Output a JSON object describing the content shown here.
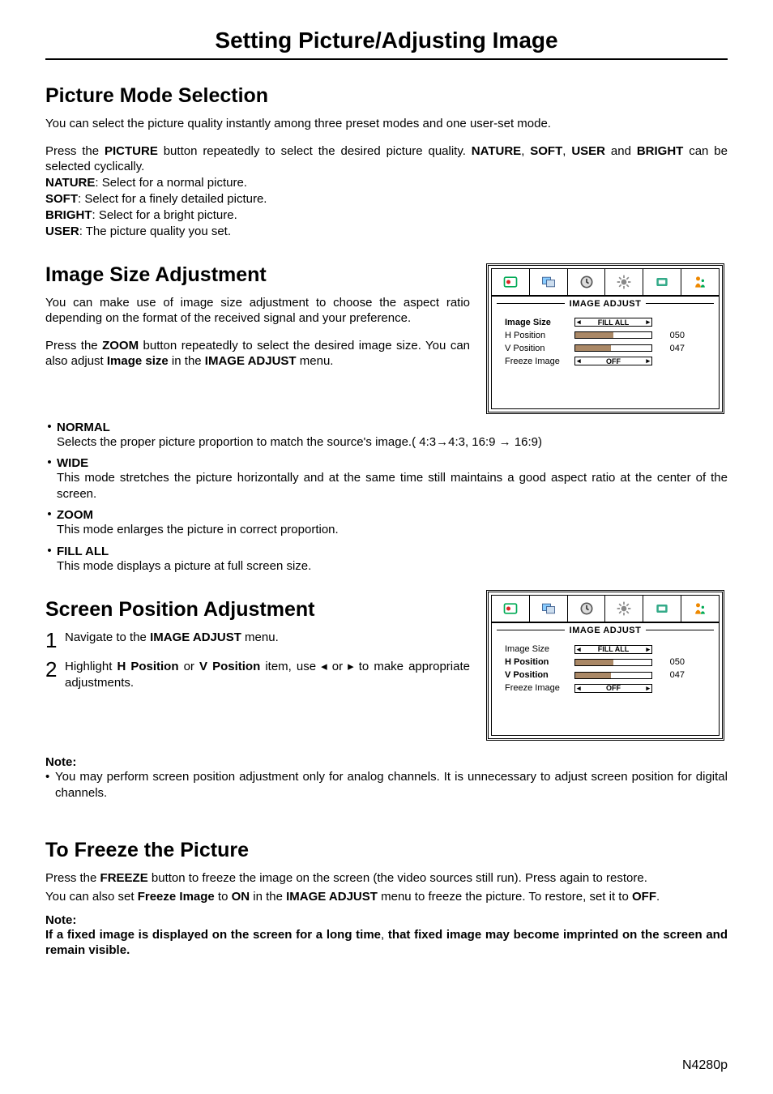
{
  "page_title": "Setting Picture/Adjusting Image",
  "footer_model": "N4280p",
  "sections": {
    "pms": {
      "heading": "Picture Mode Selection",
      "intro": "You can select the picture quality instantly among three preset modes and one user-set mode.",
      "p1_a": "Press the ",
      "p1_b": "PICTURE",
      "p1_c": " button repeatedly to select the desired picture quality. ",
      "p1_d": "NATURE",
      "p1_e": ", ",
      "p1_f": "SOFT",
      "p1_g": ", ",
      "p1_h": "USER",
      "p1_i": " and ",
      "p1_j": "BRIGHT",
      "p1_k": " can be selected cyclically.",
      "l1_a": "NATURE",
      "l1_b": ": Select for a normal picture.",
      "l2_a": "SOFT",
      "l2_b": ": Select for a finely detailed picture.",
      "l3_a": "BRIGHT",
      "l3_b": ": Select for a bright picture.",
      "l4_a": "USER",
      "l4_b": ": The picture quality you set."
    },
    "isa": {
      "heading": "Image Size Adjustment",
      "p1": "You can make use of image size adjustment to choose the aspect ratio depending on the format of the received signal and your preference.",
      "p2_a": "Press the ",
      "p2_b": "ZOOM",
      "p2_c": " button repeatedly to select the desired image size. You can also adjust ",
      "p2_d": "Image size",
      "p2_e": " in the ",
      "p2_f": "IMAGE ADJUST",
      "p2_g": " menu.",
      "modes": {
        "m1_l": "NORMAL",
        "m1_d": "Selects the proper picture proportion to match the source's image.( 4:3→4:3, 16:9 → 16:9)",
        "m2_l": "WIDE",
        "m2_d": "This mode stretches the picture horizontally and at the same time still maintains a good aspect ratio at the center of the screen.",
        "m3_l": "ZOOM",
        "m3_d": "This mode enlarges the picture in correct proportion.",
        "m4_l": "FILL ALL",
        "m4_d": "This mode displays a picture at full screen size."
      }
    },
    "spa": {
      "heading": "Screen Position Adjustment",
      "s1_a": "Navigate to the ",
      "s1_b": "IMAGE ADJUST",
      "s1_c": " menu.",
      "s2_a": "Highlight ",
      "s2_b": "H Position",
      "s2_c": " or ",
      "s2_d": "V Position",
      "s2_e": " item, use  ◂ or ▸ to make appropriate adjustments.",
      "note_h": "Note",
      "note_b": "You may perform screen position adjustment only for analog channels. It is unnecessary to adjust screen position for digital channels."
    },
    "freeze": {
      "heading": "To Freeze the Picture",
      "p1_a": "Press the ",
      "p1_b": "FREEZE",
      "p1_c": " button to freeze the image on the screen (the video sources still run). Press again to restore.",
      "p2_a": "You can also set ",
      "p2_b": "Freeze Image",
      "p2_c": " to ",
      "p2_d": "ON",
      "p2_e": " in the ",
      "p2_f": "IMAGE ADJUST",
      "p2_g": " menu to freeze the picture. To restore, set it to ",
      "p2_h": "OFF",
      "p2_i": ".",
      "note_h": "Note",
      "warn_a": "If a fixed image is displayed on the screen for a long time",
      "warn_b": ", ",
      "warn_c": "that fixed image may become imprinted on the screen and remain visible",
      "warn_d": "."
    }
  },
  "osd1": {
    "title": "IMAGE ADJUST",
    "rows": {
      "r1_l": "Image Size",
      "r1_v": "FILL ALL",
      "r1_bold": true,
      "r2_l": "H Position",
      "r2_v": "050",
      "r3_l": "V Position",
      "r3_v": "047",
      "r4_l": "Freeze Image",
      "r4_v": "OFF"
    }
  },
  "osd2": {
    "title": "IMAGE ADJUST",
    "rows": {
      "r1_l": "Image Size",
      "r1_v": "FILL ALL",
      "r2_l": "H Position",
      "r2_v": "050",
      "r2_bold": true,
      "r3_l": "V Position",
      "r3_v": "047",
      "r3_bold": true,
      "r4_l": "Freeze Image",
      "r4_v": "OFF"
    }
  }
}
